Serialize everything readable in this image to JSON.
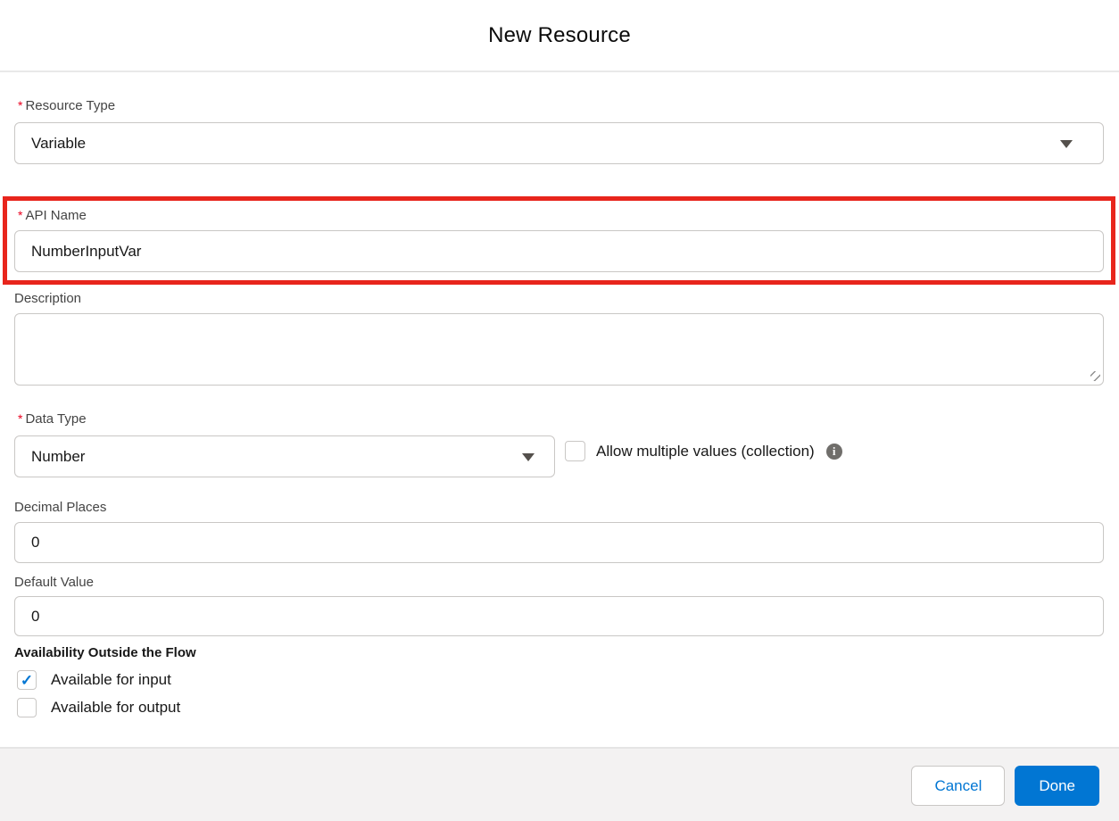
{
  "dialog": {
    "title": "New Resource"
  },
  "icons": {
    "required_marker": "*",
    "checkmark_glyph": "✓",
    "info_glyph": "i",
    "dropdown_arrow": "triangle-down",
    "resize_handle": "diagonal-grip"
  },
  "colors": {
    "accent_blue": "#0176d3",
    "highlight_red": "#e8251c",
    "required_red": "#ea001e",
    "footer_bg": "#f3f2f2",
    "input_border": "#c9c7c5"
  },
  "fields": {
    "resource_type": {
      "label": "Resource Type",
      "required": true,
      "value": "Variable"
    },
    "api_name": {
      "label": "API Name",
      "required": true,
      "value": "NumberInputVar",
      "highlighted": true
    },
    "description": {
      "label": "Description",
      "value": ""
    },
    "data_type": {
      "label": "Data Type",
      "required": true,
      "value": "Number"
    },
    "allow_multiple": {
      "label": "Allow multiple values (collection)",
      "checked": false
    },
    "decimal_places": {
      "label": "Decimal Places",
      "value": "0"
    },
    "default_value": {
      "label": "Default Value",
      "value": "0"
    },
    "availability": {
      "heading": "Availability Outside the Flow",
      "input": {
        "label": "Available for input",
        "checked": true
      },
      "output": {
        "label": "Available for output",
        "checked": false
      }
    }
  },
  "footer": {
    "cancel_label": "Cancel",
    "done_label": "Done"
  }
}
